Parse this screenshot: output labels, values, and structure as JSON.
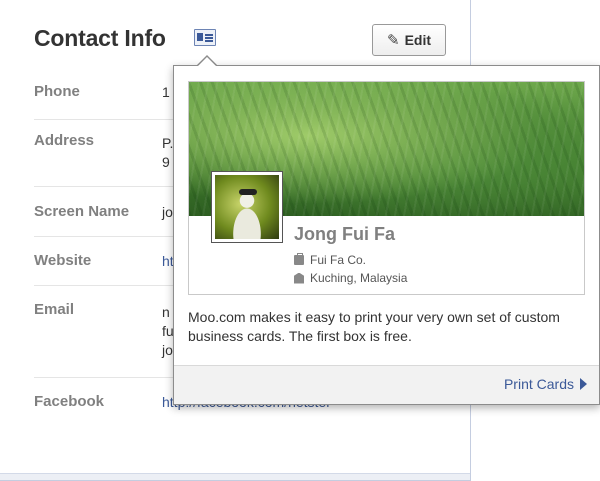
{
  "section": {
    "title": "Contact Info",
    "edit_label": "Edit",
    "title_icon": "business-card-icon",
    "edit_icon": "pencil-icon"
  },
  "rows": [
    {
      "label": "Phone",
      "value": "1"
    },
    {
      "label": "Address",
      "value_lines": [
        "P.",
        "9"
      ]
    },
    {
      "label": "Screen Name",
      "value": "jo"
    },
    {
      "label": "Website",
      "value": "ht"
    },
    {
      "label": "Email",
      "value_lines": [
        "n",
        "fu",
        "jo"
      ]
    },
    {
      "label": "Facebook",
      "value": "http://facebook.com/netster"
    }
  ],
  "popup": {
    "card": {
      "name": "Jong Fui Fa",
      "company": "Fui Fa Co.",
      "location": "Kuching, Malaysia",
      "company_icon": "briefcase-icon",
      "location_icon": "building-icon"
    },
    "promo_text": "Moo.com makes it easy to print your very own set of custom business cards. The first box is free.",
    "print_link": "Print Cards",
    "print_icon": "triangle-right-icon"
  },
  "colors": {
    "link": "#3b5998",
    "label": "#808080",
    "text": "#333333"
  }
}
